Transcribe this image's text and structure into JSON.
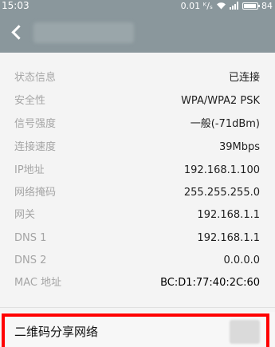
{
  "status_bar": {
    "time": "15:03",
    "speed": "0.01 ᴷ/ₛ",
    "battery_level": "84",
    "battery_fraction": 0.84,
    "icons": [
      "wifi-icon",
      "signal-icon",
      "battery-icon"
    ]
  },
  "app_bar": {
    "back_icon": "back-arrow-icon"
  },
  "info": [
    {
      "label": "状态信息",
      "value": "已连接"
    },
    {
      "label": "安全性",
      "value": "WPA/WPA2 PSK"
    },
    {
      "label": "信号强度",
      "value": "一般(-71dBm)"
    },
    {
      "label": "连接速度",
      "value": "39Mbps"
    },
    {
      "label": "IP地址",
      "value": "192.168.1.100"
    },
    {
      "label": "网络掩码",
      "value": "255.255.255.0"
    },
    {
      "label": "网关",
      "value": "192.168.1.1"
    },
    {
      "label": "DNS 1",
      "value": "192.168.1.1"
    },
    {
      "label": "DNS 2",
      "value": "0.0.0.0"
    },
    {
      "label": "MAC 地址",
      "value": "BC:D1:77:40:2C:60"
    }
  ],
  "share": {
    "label": "二维码分享网络"
  },
  "colors": {
    "header": "#8a979c",
    "highlight": "#ff0000"
  }
}
